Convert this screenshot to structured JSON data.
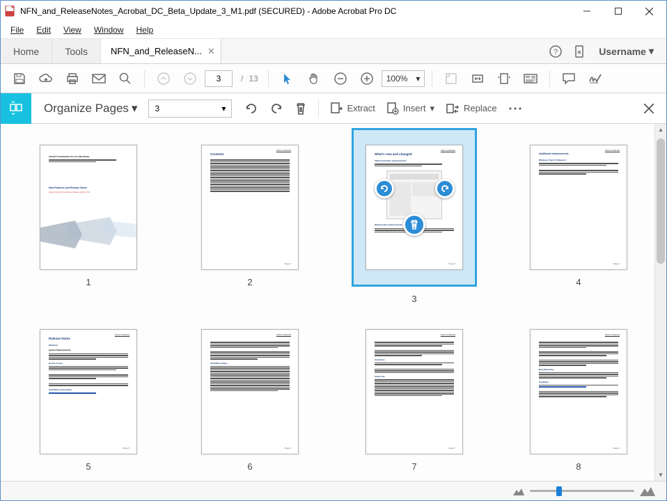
{
  "window": {
    "title": "NFN_and_ReleaseNotes_Acrobat_DC_Beta_Update_3_M1.pdf (SECURED) - Adobe Acrobat Pro DC"
  },
  "menu": {
    "file": "File",
    "edit": "Edit",
    "view": "View",
    "window": "Window",
    "help": "Help"
  },
  "tabs": {
    "home": "Home",
    "tools": "Tools",
    "file": "NFN_and_ReleaseN..."
  },
  "user": {
    "name": "Username"
  },
  "toolbar": {
    "page_current": "3",
    "page_total": "13",
    "page_sep": "/",
    "zoom": "100%"
  },
  "organize": {
    "title": "Organize Pages",
    "page_select": "3",
    "extract": "Extract",
    "insert": "Insert",
    "replace": "Replace"
  },
  "thumbs": {
    "p1": {
      "num": "1",
      "title": "New Features and Release Notes",
      "sub": "Adobe® Confidential. Do not redistribute.",
      "line": "Adobe Acrobat DC Continuous Release Update 3 M1"
    },
    "p2": {
      "num": "2",
      "title": "Contents"
    },
    "p3": {
      "num": "3",
      "title": "What's new and changed",
      "sub": "Tabbed Interface enhancements",
      "sec": "Window title enhancements"
    },
    "p4": {
      "num": "4",
      "title": "Additional enhancements",
      "sub": "Windows Touch UI Support"
    },
    "p5": {
      "num": "5",
      "title": "Release Notes",
      "sub": "Windows",
      "sec": "System Requirements"
    },
    "p6": {
      "num": "6"
    },
    "p7": {
      "num": "7"
    },
    "p8": {
      "num": "8"
    }
  }
}
